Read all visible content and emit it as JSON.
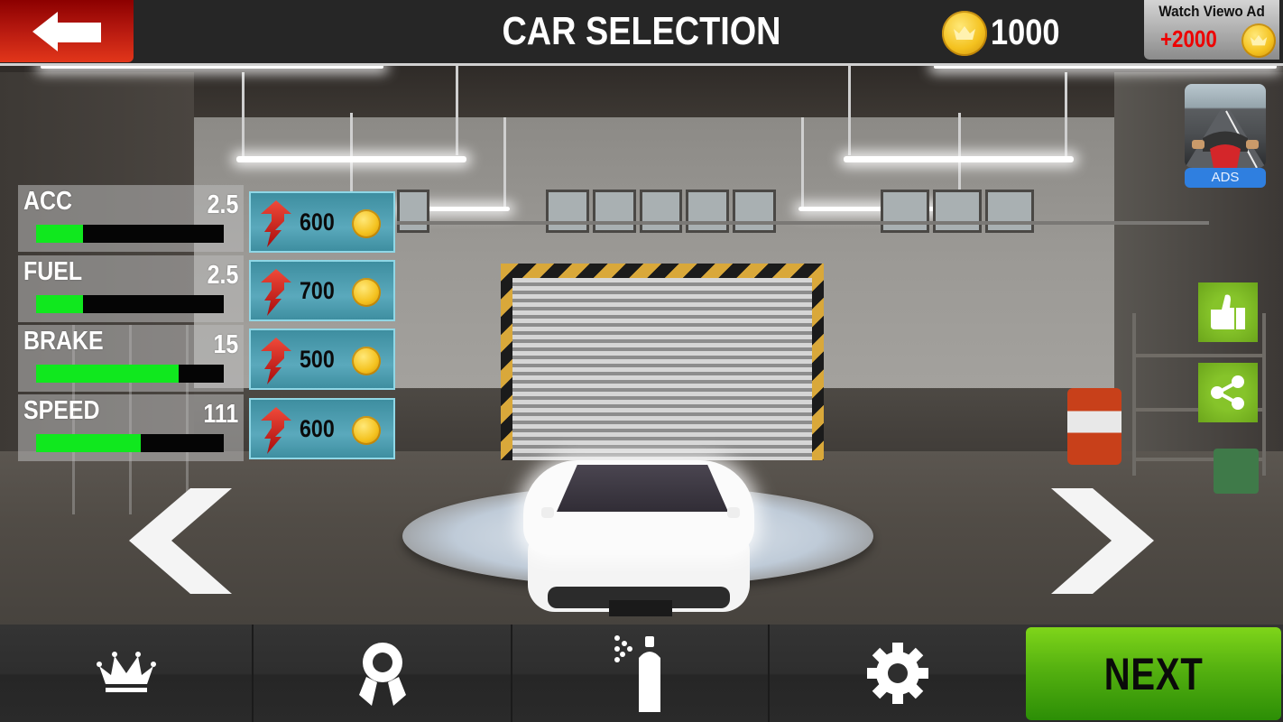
{
  "header": {
    "title": "CAR SELECTION",
    "back_icon": "arrow-left-icon",
    "coin_balance": "1000",
    "coin_icon": "crown-coin-icon",
    "watch_ad": {
      "label": "Watch Viewo Ad",
      "reward": "+2000",
      "icon": "crown-coin-icon"
    }
  },
  "stats": [
    {
      "label": "ACC",
      "value": "2.5",
      "level": 0.25,
      "upgrade_price": "600"
    },
    {
      "label": "FUEL",
      "value": "2.5",
      "level": 0.25,
      "upgrade_price": "700"
    },
    {
      "label": "BRAKE",
      "value": "15",
      "level": 0.76,
      "upgrade_price": "500"
    },
    {
      "label": "SPEED",
      "value": "111",
      "level": 0.56,
      "upgrade_price": "600"
    }
  ],
  "upgrade_icon": "red-up-arrow-icon",
  "ads": {
    "label": "ADS"
  },
  "side_buttons": [
    {
      "name": "like",
      "icon": "thumbs-up-icon"
    },
    {
      "name": "share",
      "icon": "share-icon"
    }
  ],
  "navigation": {
    "prev_icon": "chevron-left-icon",
    "next_icon": "chevron-right-icon"
  },
  "bottom_bar": {
    "items": [
      {
        "name": "leaderboard",
        "icon": "crown-icon"
      },
      {
        "name": "achievements",
        "icon": "award-ribbon-icon"
      },
      {
        "name": "paint",
        "icon": "spray-can-icon"
      },
      {
        "name": "settings",
        "icon": "gear-icon"
      }
    ],
    "next_label": "NEXT"
  },
  "colors": {
    "stat_fill": "#10e81e",
    "next_green": "#55b110",
    "back_red": "#b81a10",
    "ad_reward_red": "#e00000",
    "upgrade_teal": "#4a9bb0",
    "side_green": "#7ab823",
    "ads_blue": "#2f7fe0"
  }
}
